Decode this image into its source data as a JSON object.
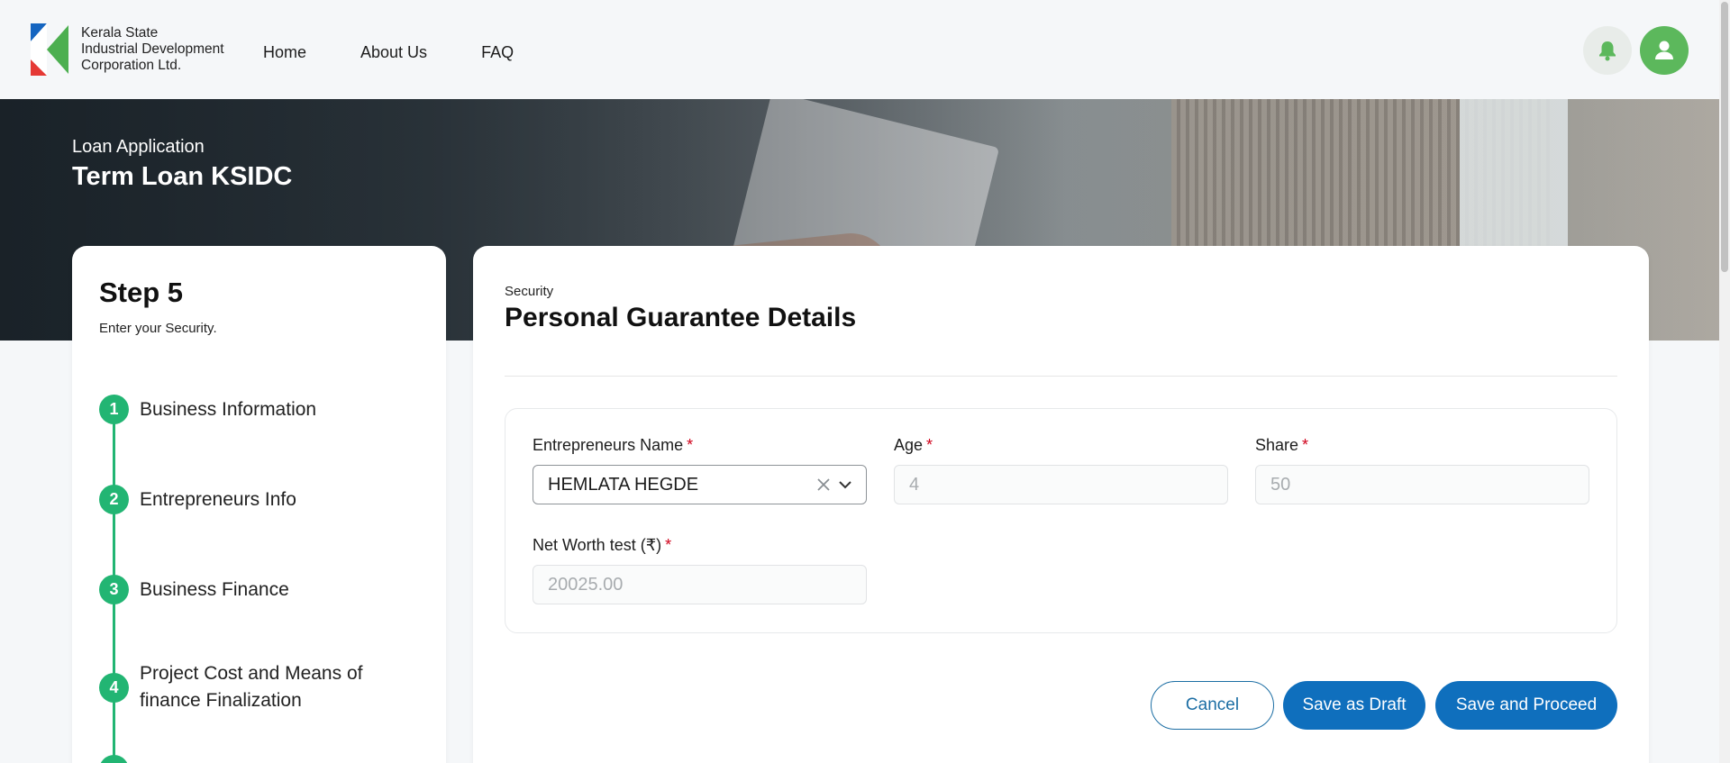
{
  "brand": {
    "line1": "Kerala State",
    "line2": "Industrial Development",
    "line3": "Corporation Ltd."
  },
  "nav": [
    "Home",
    "About Us",
    "FAQ"
  ],
  "hero": {
    "subtitle": "Loan Application",
    "title": "Term Loan KSIDC"
  },
  "steps_panel": {
    "title": "Step 5",
    "description": "Enter your Security.",
    "steps": [
      {
        "num": "1",
        "label": "Business Information"
      },
      {
        "num": "2",
        "label": "Entrepreneurs Info"
      },
      {
        "num": "3",
        "label": "Business Finance"
      },
      {
        "num": "4",
        "label": "Project Cost and Means of finance Finalization"
      }
    ]
  },
  "form": {
    "section_sub": "Security",
    "section_title": "Personal Guarantee Details",
    "fields": {
      "name": {
        "label": "Entrepreneurs Name",
        "value": "HEMLATA HEGDE"
      },
      "age": {
        "label": "Age",
        "value": "4"
      },
      "share": {
        "label": "Share",
        "value": "50"
      },
      "net_worth": {
        "label": "Net Worth test (₹)",
        "value": "20025.00"
      }
    },
    "required_mark": "*",
    "buttons": {
      "cancel": "Cancel",
      "draft": "Save as Draft",
      "proceed": "Save and Proceed"
    }
  },
  "icons": {
    "bell": "bell-icon",
    "user": "user-icon",
    "clear": "close-icon",
    "dropdown": "chevron-down-icon"
  },
  "colors": {
    "accent_green": "#22b573",
    "primary_blue": "#0f6fbd",
    "required_red": "#d0021b"
  }
}
